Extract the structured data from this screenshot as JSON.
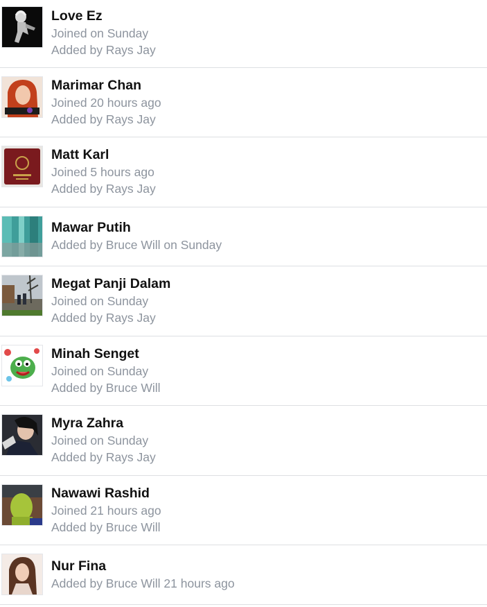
{
  "members": [
    {
      "name": "Love Ez",
      "lines": [
        "Joined on Sunday",
        "Added by Rays Jay"
      ],
      "avatar": "avatar-bw-figure"
    },
    {
      "name": "Marimar Chan",
      "lines": [
        "Joined 20 hours ago",
        "Added by Rays Jay"
      ],
      "avatar": "avatar-red-hair-portrait"
    },
    {
      "name": "Matt Karl",
      "lines": [
        "Joined 5 hours ago",
        "Added by Rays Jay"
      ],
      "avatar": "avatar-passport"
    },
    {
      "name": "Mawar Putih",
      "lines": [
        "Added by Bruce Will on Sunday"
      ],
      "avatar": "avatar-teal-blur"
    },
    {
      "name": "Megat Panji Dalam",
      "lines": [
        "Joined on Sunday",
        "Added by Rays Jay"
      ],
      "avatar": "avatar-street-scene"
    },
    {
      "name": "Minah Senget",
      "lines": [
        "Joined on Sunday",
        "Added by Bruce Will"
      ],
      "avatar": "avatar-green-monster-cartoon"
    },
    {
      "name": "Myra Zahra",
      "lines": [
        "Joined on Sunday",
        "Added by Rays Jay"
      ],
      "avatar": "avatar-dark-selfie"
    },
    {
      "name": "Nawawi Rashid",
      "lines": [
        "Joined 21 hours ago",
        "Added by Bruce Will"
      ],
      "avatar": "avatar-green-jacket"
    },
    {
      "name": "Nur Fina",
      "lines": [
        "Added by Bruce Will 21 hours ago"
      ],
      "avatar": "avatar-girl-portrait"
    }
  ]
}
